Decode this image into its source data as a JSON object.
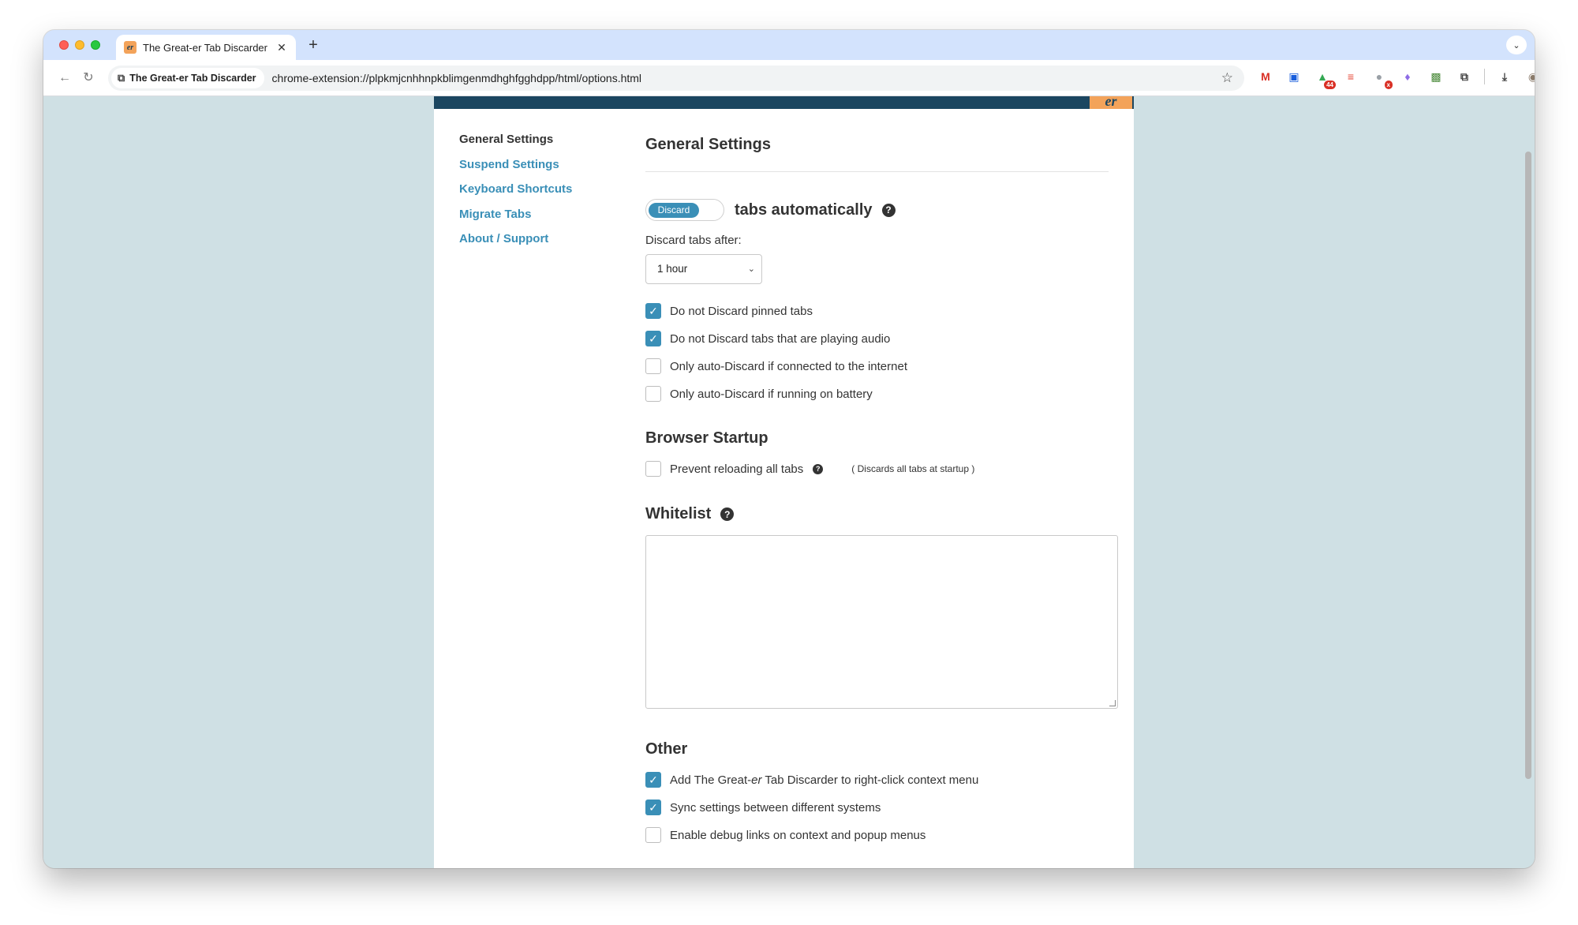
{
  "browser": {
    "tab": {
      "title": "The Great-er Tab Discarder |",
      "favicon_text": "er"
    },
    "new_tab_symbol": "+",
    "site_chip": "The Great-er Tab Discarder",
    "url": "chrome-extension://plpkmjcnhhnpkblimgenmdhghfgghdpp/html/options.html",
    "extensions": [
      {
        "icon": "gmail-icon",
        "glyph": "M",
        "color": "#d93025",
        "badge": ""
      },
      {
        "icon": "bitwarden-icon",
        "glyph": "▣",
        "color": "#175ddc",
        "badge": ""
      },
      {
        "icon": "stock-icon",
        "glyph": "▲",
        "color": "#34a853",
        "badge": "44"
      },
      {
        "icon": "todoist-icon",
        "glyph": "≡",
        "color": "#e44332",
        "badge": ""
      },
      {
        "icon": "privacy-icon",
        "glyph": "●",
        "color": "#9aa0a6",
        "badge": "x"
      },
      {
        "icon": "flask-icon",
        "glyph": "♦",
        "color": "#8e6ce6",
        "badge": ""
      },
      {
        "icon": "screenshot-icon",
        "glyph": "▩",
        "color": "#4a8a3a",
        "badge": ""
      },
      {
        "icon": "puzzle-icon",
        "glyph": "⧉",
        "color": "#444444",
        "badge": ""
      }
    ]
  },
  "sidebar": {
    "items": [
      {
        "label": "General Settings",
        "active": true
      },
      {
        "label": "Suspend Settings",
        "active": false
      },
      {
        "label": "Keyboard Shortcuts",
        "active": false
      },
      {
        "label": "Migrate Tabs",
        "active": false
      },
      {
        "label": "About / Support",
        "active": false
      }
    ]
  },
  "general": {
    "title": "General Settings",
    "toggle_label": "Discard",
    "toggle_text": "tabs automatically",
    "discard_after_label": "Discard tabs after:",
    "discard_after_value": "1 hour",
    "options": [
      {
        "label": "Do not Discard pinned tabs",
        "checked": true
      },
      {
        "label": "Do not Discard tabs that are playing audio",
        "checked": true
      },
      {
        "label": "Only auto-Discard if connected to the internet",
        "checked": false
      },
      {
        "label": "Only auto-Discard if running on battery",
        "checked": false
      }
    ]
  },
  "startup": {
    "title": "Browser Startup",
    "option_label": "Prevent reloading all tabs",
    "checked": false,
    "note": "( Discards all tabs at startup )"
  },
  "whitelist": {
    "title": "Whitelist",
    "value": ""
  },
  "other": {
    "title": "Other",
    "options": [
      {
        "label_pre": "Add The Great-",
        "label_em": "er",
        "label_post": " Tab Discarder to right-click context menu",
        "checked": true
      },
      {
        "label": "Sync settings between different systems",
        "checked": true
      },
      {
        "label": "Enable debug links on context and popup menus",
        "checked": false
      }
    ]
  },
  "colors": {
    "accent": "#3a8fb7",
    "banner": "#1b4660",
    "logo": "#f3a35a",
    "page_bg": "#cfe0e4"
  }
}
